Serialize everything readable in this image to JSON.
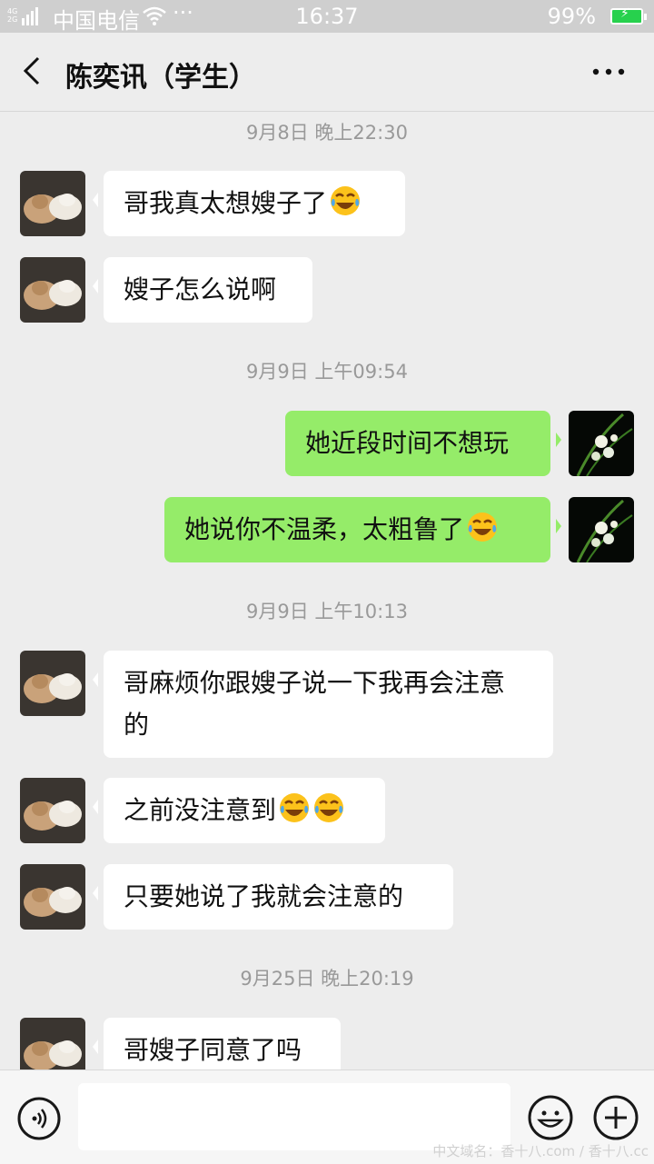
{
  "status": {
    "network_top": "4G",
    "network_bottom": "2G",
    "carrier": "中国电信",
    "more": "···",
    "time": "16:37",
    "battery": "99%"
  },
  "header": {
    "title": "陈奕讯（学生）"
  },
  "timestamps": [
    "9月8日 晚上22:30",
    "9月9日 上午09:54",
    "9月9日 上午10:13",
    "9月25日 晚上20:19"
  ],
  "messages": [
    {
      "side": "left",
      "text": "哥我真太想嫂子了",
      "emoji": "face-with-tears-of-joy"
    },
    {
      "side": "left",
      "text": "嫂子怎么说啊"
    },
    {
      "side": "right",
      "text": "她近段时间不想玩"
    },
    {
      "side": "right",
      "text": "她说你不温柔，太粗鲁了",
      "emoji": "face-with-tears-of-joy"
    },
    {
      "side": "left",
      "text_line1": "哥麻烦你跟嫂子说一下我再会注意",
      "text_line2": "的"
    },
    {
      "side": "left",
      "text": "之前没注意到",
      "emoji": "face-with-tears-of-joy x2"
    },
    {
      "side": "left",
      "text": "只要她说了我就会注意的"
    },
    {
      "side": "left",
      "text": "哥嫂子同意了吗"
    }
  ],
  "watermark": "中文域名：香十八.com / 香十八.cc",
  "colors": {
    "my_bubble": "#95ec69",
    "their_bubble": "#ffffff",
    "background": "#ededed"
  }
}
